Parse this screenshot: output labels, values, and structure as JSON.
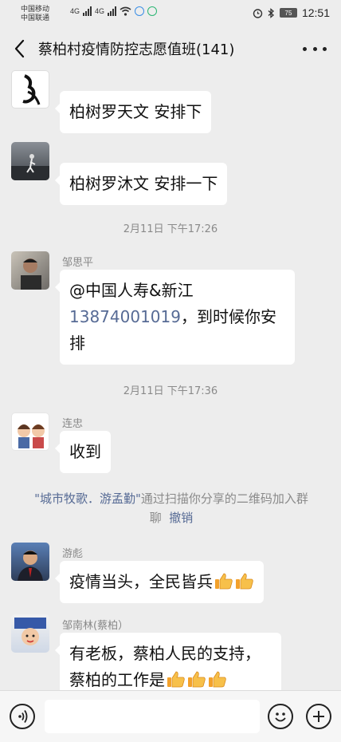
{
  "status_bar": {
    "carrier1": "中国移动",
    "carrier2": "中国联通",
    "network1": "4G",
    "network2": "4G",
    "battery": "75",
    "time": "12:51"
  },
  "header": {
    "title": "蔡柏村疫情防控志愿值班(141)"
  },
  "messages": [
    {
      "text": "柏树罗天文   安排下"
    },
    {
      "text": "柏树罗沐文   安排一下"
    },
    {
      "timestamp": "2月11日 下午17:26"
    },
    {
      "sender": "邹思平",
      "line1_prefix": "@中国人寿&新江",
      "phone": "13874001019",
      "line2_suffix": "，到时候你安",
      "line3": "排"
    },
    {
      "timestamp": "2月11日 下午17:36"
    },
    {
      "sender": "连忠",
      "text": "收到"
    },
    {
      "system": {
        "names": "\"城市牧歌．游孟勤\"",
        "text": "通过扫描你分享的二维码加入群聊",
        "link": "撤销"
      }
    },
    {
      "sender": "游彪",
      "text": "疫情当头，全民皆兵"
    },
    {
      "sender": "邹南林(蔡柏）",
      "line1": "有老板，蔡柏人民的支持，",
      "line2": "蔡柏的工作是"
    }
  ],
  "icons": {
    "back": "chevron-left-icon",
    "more": "more-dots-icon",
    "voice": "voice-icon",
    "emoji": "emoji-icon",
    "plus": "plus-icon",
    "thumb": "thumbs-up-emoji"
  },
  "colors": {
    "background": "#ededed",
    "bubble": "#ffffff",
    "link": "#576b95",
    "timestamp": "#8a8a8a"
  }
}
